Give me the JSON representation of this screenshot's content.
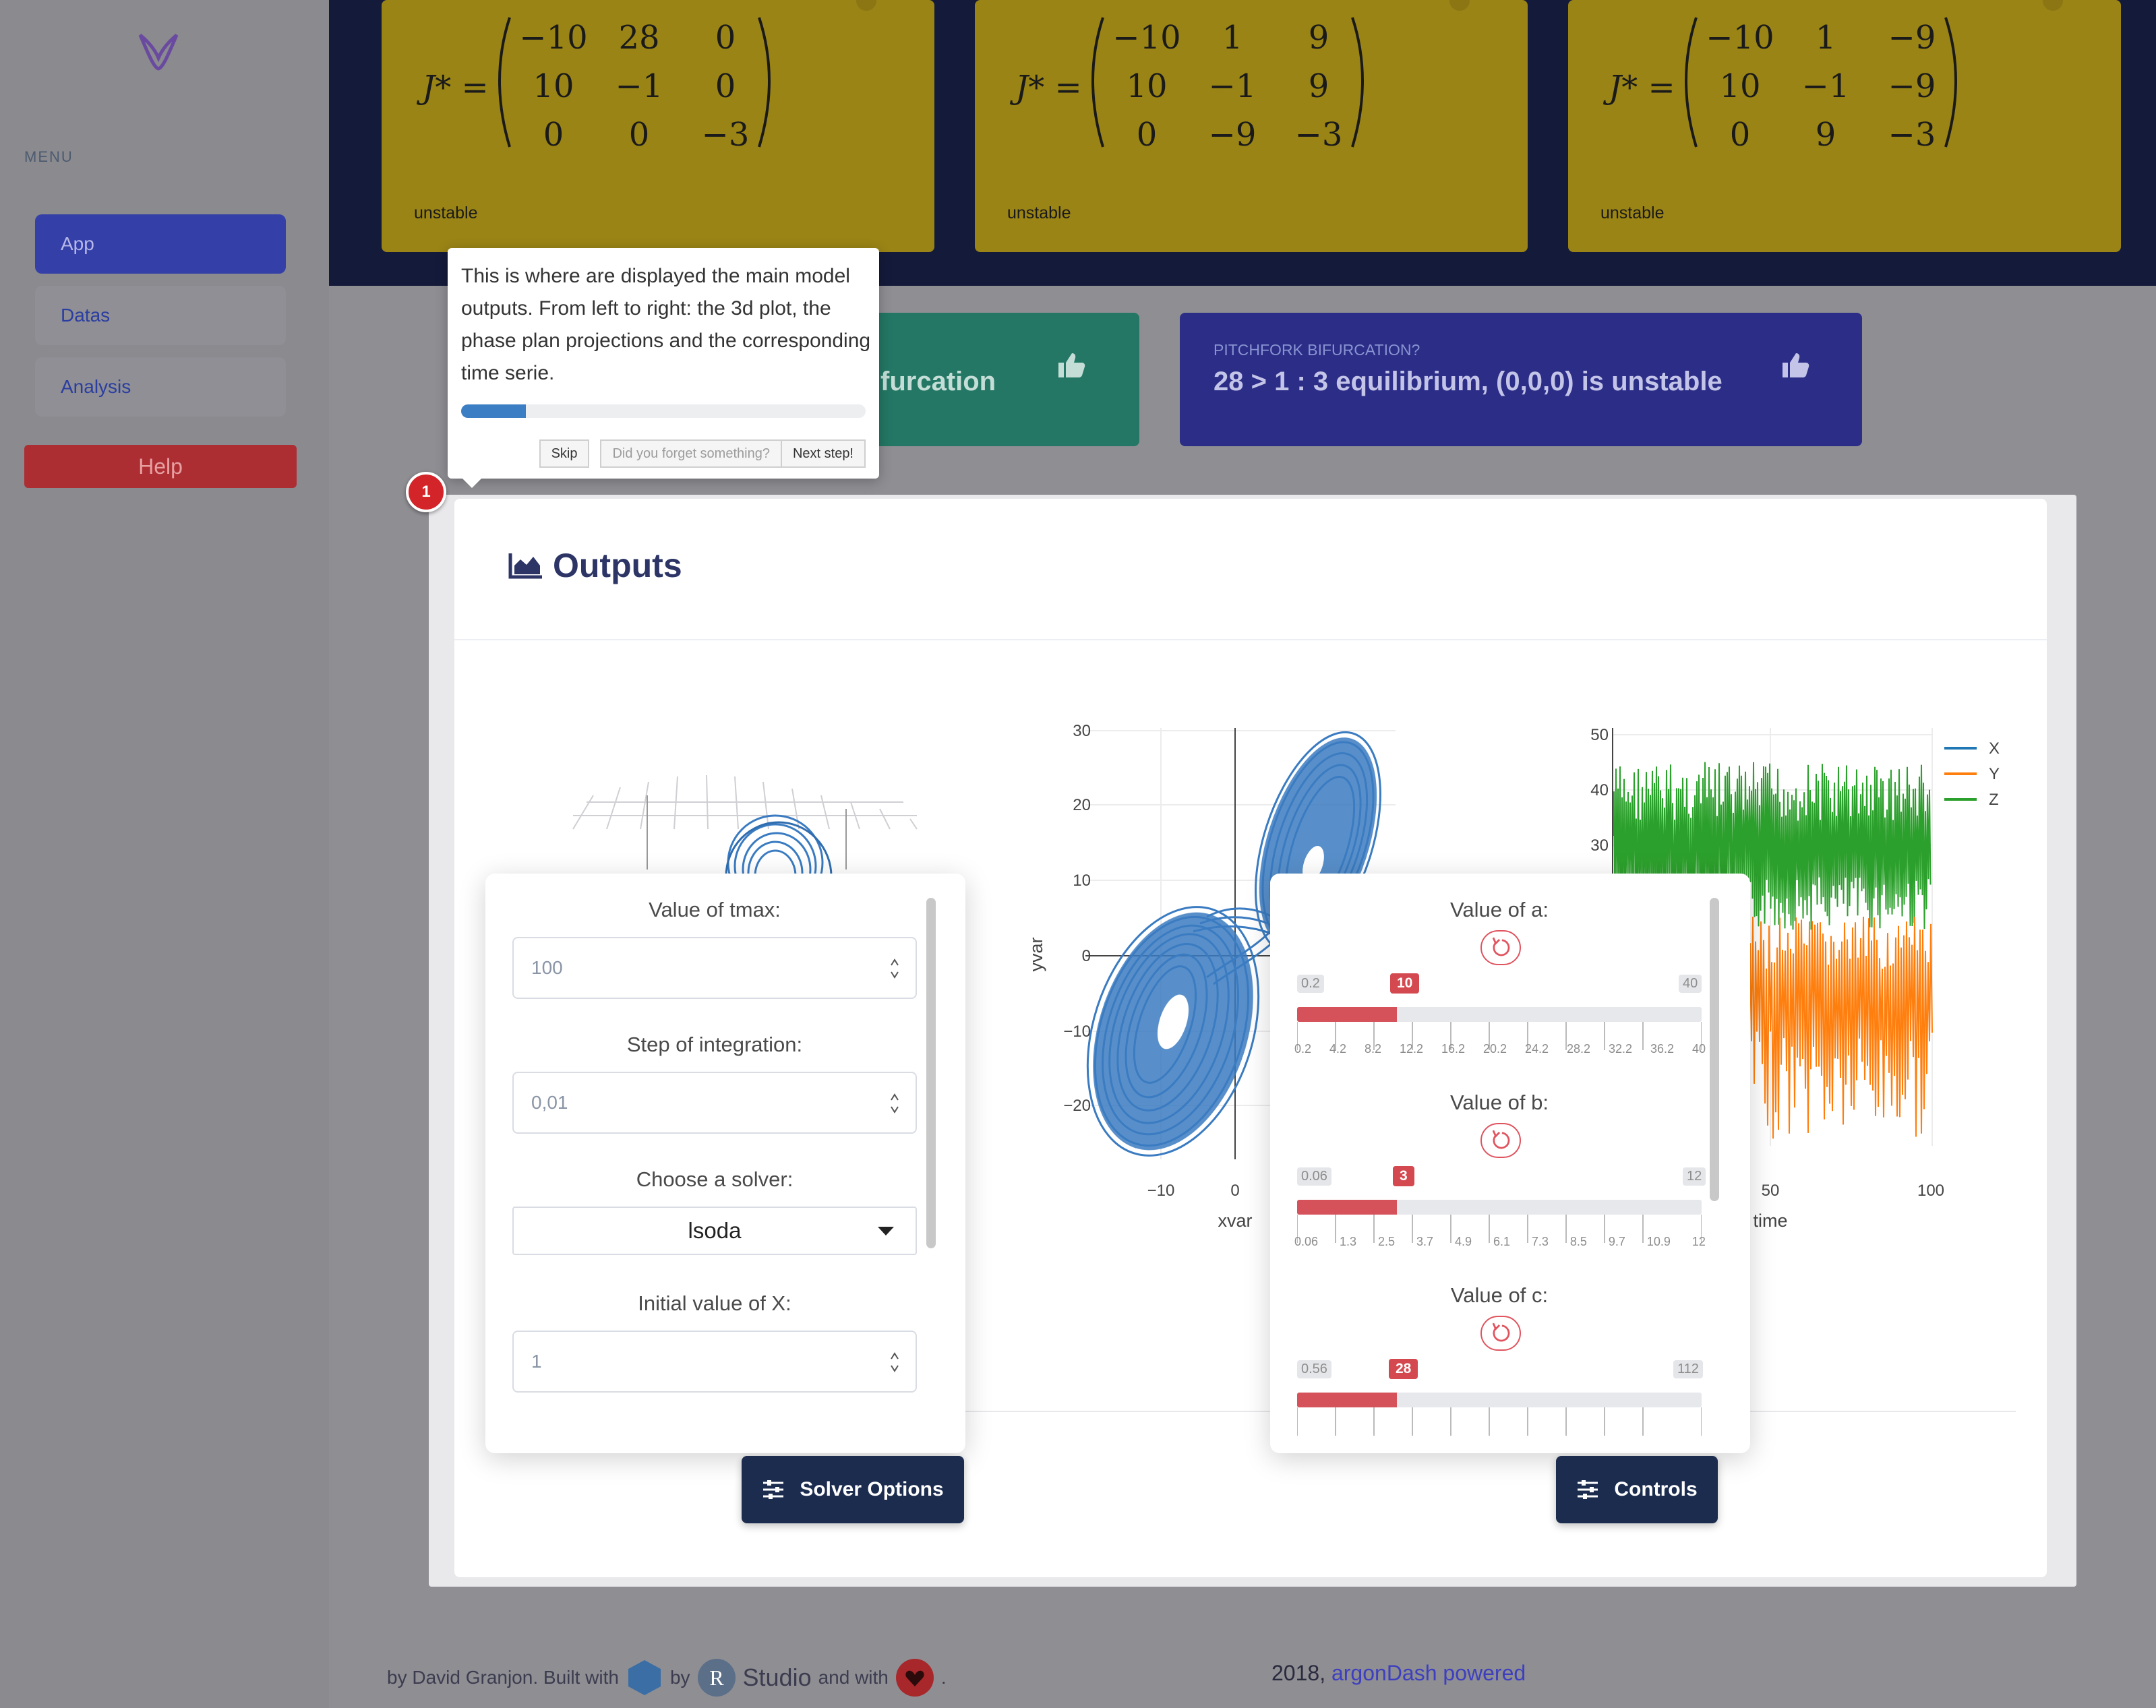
{
  "sidebar": {
    "menu_title": "MENU",
    "items": [
      {
        "label": "App",
        "active": true
      },
      {
        "label": "Datas",
        "active": false
      },
      {
        "label": "Analysis",
        "active": false
      }
    ],
    "help_label": "Help"
  },
  "jacobians": [
    {
      "symbol": "J* =",
      "matrix": [
        [
          "−10",
          "28",
          "0"
        ],
        [
          "10",
          "−1",
          "0"
        ],
        [
          "0",
          "0",
          "−3"
        ]
      ],
      "status": "unstable"
    },
    {
      "symbol": "J* =",
      "matrix": [
        [
          "−10",
          "1",
          "9"
        ],
        [
          "10",
          "−1",
          "9"
        ],
        [
          "0",
          "−9",
          "−3"
        ]
      ],
      "status": "unstable"
    },
    {
      "symbol": "J* =",
      "matrix": [
        [
          "−10",
          "1",
          "−9"
        ],
        [
          "10",
          "−1",
          "−9"
        ],
        [
          "0",
          "9",
          "−3"
        ]
      ],
      "status": "unstable"
    }
  ],
  "bifurcation": {
    "green": {
      "main": "furcation"
    },
    "purple": {
      "sub": "PITCHFORK BIFURCATION?",
      "main": "28 > 1 : 3 equilibrium, (0,0,0) is unstable"
    }
  },
  "tour": {
    "text": "This is where are displayed the main model outputs. From left to right: the 3d plot, the phase plan projections and the corresponding time serie.",
    "progress": 0.16,
    "skip_label": "Skip",
    "forgot_label": "Did you forget something?",
    "next_label": "Next step!",
    "step_badge": "1"
  },
  "outputs": {
    "title": "Outputs",
    "phase_plot": {
      "xlabel": "xvar",
      "ylabel": "yvar",
      "yticks": [
        "30",
        "20",
        "10",
        "0",
        "−10",
        "−20"
      ],
      "xticks": [
        "−10",
        "0"
      ]
    },
    "time_plot": {
      "xlabel": "time",
      "yticks": [
        "50",
        "40",
        "30"
      ],
      "xticks": [
        "50",
        "100"
      ],
      "legend": [
        "X",
        "Y",
        "Z"
      ]
    }
  },
  "solver_panel": {
    "tmax_label": "Value of tmax:",
    "tmax_value": "100",
    "step_label": "Step of integration:",
    "step_value": "0,01",
    "solver_label": "Choose a solver:",
    "solver_value": "lsoda",
    "x0_label": "Initial value of X:",
    "x0_value": "1",
    "button_label": "Solver Options"
  },
  "controls_panel": {
    "sliders": [
      {
        "label": "Value of a:",
        "min": "0.2",
        "max": "40",
        "value": "10",
        "fraction": 0.246,
        "ticks": [
          "0.2",
          "4.2",
          "8.2",
          "12.2",
          "16.2",
          "20.2",
          "24.2",
          "28.2",
          "32.2",
          "36.2",
          "40"
        ]
      },
      {
        "label": "Value of b:",
        "min": "0.06",
        "max": "12",
        "value": "3",
        "fraction": 0.246,
        "ticks": [
          "0.06",
          "1.3",
          "2.5",
          "3.7",
          "4.9",
          "6.1",
          "7.3",
          "8.5",
          "9.7",
          "10.9",
          "12"
        ]
      },
      {
        "label": "Value of c:",
        "min": "0.56",
        "max": "112",
        "value": "28",
        "fraction": 0.246,
        "ticks": []
      }
    ],
    "button_label": "Controls"
  },
  "footer": {
    "left_text_1": "by David Granjon. Built with",
    "left_text_2": "by",
    "left_studio": "Studio",
    "left_text_3": "and with",
    "right_year": "2018,",
    "right_link": "argonDash powered"
  },
  "colors": {
    "x_series": "#1f77b4",
    "y_series": "#ff7f0e",
    "z_series": "#2ca02c",
    "accent": "#d5525a",
    "jacobian_card": "#9a8416"
  }
}
